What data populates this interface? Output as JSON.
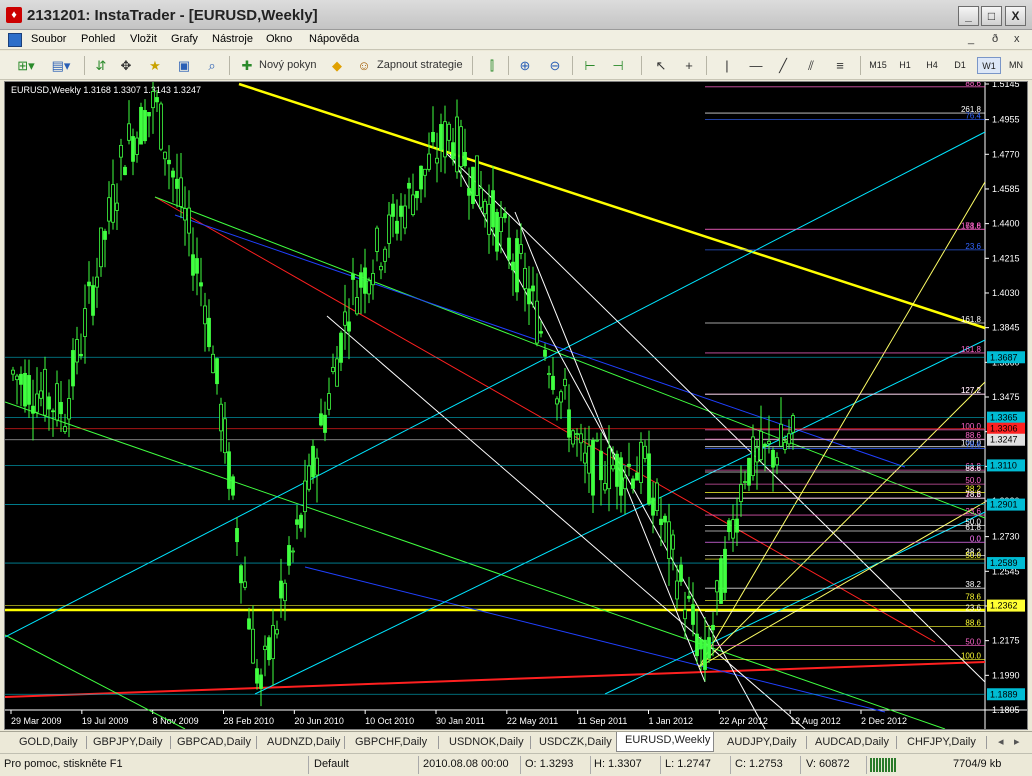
{
  "window": {
    "icon": "instatrader-logo-icon",
    "title": "2131201: InstaTrader - [EURUSD,Weekly]",
    "buttons": [
      "_",
      "□",
      "X"
    ]
  },
  "menu": {
    "items": [
      "Soubor",
      "Pohled",
      "Vložit",
      "Grafy",
      "Nástroje",
      "Okno",
      "Nápověda"
    ],
    "mdi_buttons": [
      "_",
      "ð",
      "x"
    ]
  },
  "toolbar": {
    "new_order": "Nový pokyn",
    "start_strategy": "Zapnout strategie",
    "timeframes": [
      "M15",
      "H1",
      "H4",
      "D1",
      "W1",
      "MN"
    ],
    "active_timeframe": "W1"
  },
  "chart_data": {
    "type": "candlestick",
    "symbol_header": "EURUSD,Weekly  1.3168 1.3307 1.3143 1.3247",
    "ylim": [
      1.1805,
      1.5145
    ],
    "yticks": [
      "1.5145",
      "1.4955",
      "1.4770",
      "1.4585",
      "1.4400",
      "1.4215",
      "1.4030",
      "1.3845",
      "1.3660",
      "1.3475",
      "1.3290",
      "1.3105",
      "1.2920",
      "1.2730",
      "1.2545",
      "1.2360",
      "1.2175",
      "1.1990",
      "1.1805"
    ],
    "xticks": [
      "29 Mar 2009",
      "19 Jul 2009",
      "8 Nov 2009",
      "28 Feb 2010",
      "20 Jun 2010",
      "10 Oct 2010",
      "30 Jan 2011",
      "22 May 2011",
      "11 Sep 2011",
      "1 Jan 2012",
      "22 Apr 2012",
      "12 Aug 2012",
      "2 Dec 2012"
    ],
    "price_markers": [
      {
        "label": "1.3687",
        "value": 1.3687,
        "color": "#00bcd4"
      },
      {
        "label": "1.3365",
        "value": 1.3365,
        "color": "#00bcd4"
      },
      {
        "label": "1.3306",
        "value": 1.3306,
        "color": "#ff2020"
      },
      {
        "label": "1.3247",
        "value": 1.3247,
        "color": "#e0e0e0"
      },
      {
        "label": "1.3110",
        "value": 1.311,
        "color": "#00bcd4"
      },
      {
        "label": "1.2901",
        "value": 1.2901,
        "color": "#00bcd4"
      },
      {
        "label": "1.2589",
        "value": 1.2589,
        "color": "#00bcd4"
      },
      {
        "label": "1.2362",
        "value": 1.2362,
        "color": "#ffff33"
      },
      {
        "label": "1.1889",
        "value": 1.1889,
        "color": "#00bcd4"
      }
    ],
    "fib_labels": [
      {
        "text": "88.6",
        "value": 1.513,
        "color": "#ff66cc"
      },
      {
        "text": "261.8",
        "value": 1.499,
        "color": "#ffffff"
      },
      {
        "text": "76.4",
        "value": 1.4955,
        "color": "#3366ff"
      },
      {
        "text": "161.8",
        "value": 1.437,
        "color": "#ff66cc"
      },
      {
        "text": "78.6",
        "value": 1.437,
        "color": "#ff66cc"
      },
      {
        "text": "23.6",
        "value": 1.426,
        "color": "#3366ff"
      },
      {
        "text": "161.8",
        "value": 1.387,
        "color": "#ffffff"
      },
      {
        "text": "161.8",
        "value": 1.371,
        "color": "#ff66cc"
      },
      {
        "text": "127.2",
        "value": 1.349,
        "color": "#ff66cc"
      },
      {
        "text": "127.2",
        "value": 1.349,
        "color": "#ffffff"
      },
      {
        "text": "100.0",
        "value": 1.33,
        "color": "#ff66cc"
      },
      {
        "text": "88.6",
        "value": 1.325,
        "color": "#ff66cc"
      },
      {
        "text": "100.0",
        "value": 1.321,
        "color": "#ffffff"
      },
      {
        "text": "78.6",
        "value": 1.32,
        "color": "#3366ff"
      },
      {
        "text": "61.8",
        "value": 1.3085,
        "color": "#ff66cc"
      },
      {
        "text": "88.6",
        "value": 1.3075,
        "color": "#ffffff"
      },
      {
        "text": "50.0",
        "value": 1.301,
        "color": "#ff66cc"
      },
      {
        "text": "38.2",
        "value": 1.2965,
        "color": "#ffff33"
      },
      {
        "text": "38.2",
        "value": 1.2935,
        "color": "#ff66cc"
      },
      {
        "text": "78.6",
        "value": 1.2935,
        "color": "#ffffff"
      },
      {
        "text": "23.6",
        "value": 1.2845,
        "color": "#ff66cc"
      },
      {
        "text": "50.0",
        "value": 1.279,
        "color": "#ffffff"
      },
      {
        "text": "61.8",
        "value": 1.276,
        "color": "#ffffff"
      },
      {
        "text": "0.0",
        "value": 1.27,
        "color": "#3366ff"
      },
      {
        "text": "0.0",
        "value": 1.27,
        "color": "#ff66cc"
      },
      {
        "text": "38.2",
        "value": 1.263,
        "color": "#ffffff"
      },
      {
        "text": "50.0",
        "value": 1.261,
        "color": "#ffff33"
      },
      {
        "text": "38.2",
        "value": 1.2455,
        "color": "#ffffff"
      },
      {
        "text": "78.6",
        "value": 1.239,
        "color": "#ffff33"
      },
      {
        "text": "23.6",
        "value": 1.233,
        "color": "#ffffff"
      },
      {
        "text": "88.6",
        "value": 1.225,
        "color": "#ffff33"
      },
      {
        "text": "50.0",
        "value": 1.215,
        "color": "#ff66cc"
      },
      {
        "text": "100.0",
        "value": 1.2075,
        "color": "#ffff33"
      }
    ]
  },
  "tabs": [
    "GOLD,Daily",
    "GBPJPY,Daily",
    "GBPCAD,Daily",
    "AUDNZD,Daily",
    "GBPCHF,Daily",
    "USDNOK,Daily",
    "USDCZK,Daily",
    "EURUSD,Weekly",
    "AUDJPY,Daily",
    "AUDCAD,Daily",
    "CHFJPY,Daily"
  ],
  "active_tab": "EURUSD,Weekly",
  "status": {
    "help": "Pro pomoc, stiskněte F1",
    "profile": "Default",
    "datetime": "2010.08.08 00:00",
    "open": "O: 1.3293",
    "high": "H: 1.3307",
    "low": "L: 1.2747",
    "close": "C: 1.2753",
    "volume": "V: 60872",
    "traffic": "7704/9 kb"
  }
}
